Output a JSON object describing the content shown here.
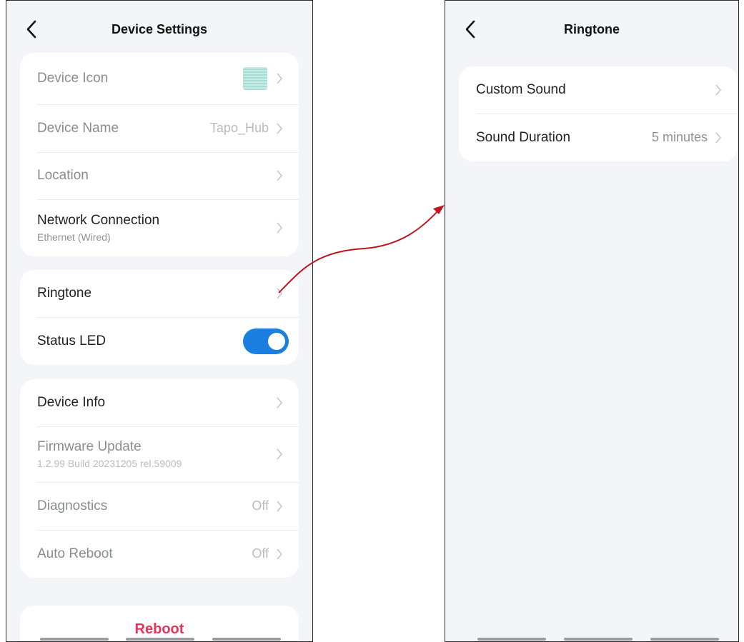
{
  "left": {
    "title": "Device Settings",
    "group1": {
      "device_icon_label": "Device Icon",
      "device_name_label": "Device Name",
      "device_name_value": "Tapo_Hub",
      "location_label": "Location",
      "network_label": "Network Connection",
      "network_sub": "Ethernet (Wired)"
    },
    "group2": {
      "ringtone_label": "Ringtone",
      "status_led_label": "Status LED",
      "status_led_on": true
    },
    "group3": {
      "device_info_label": "Device Info",
      "firmware_label": "Firmware Update",
      "firmware_sub": "1.2.99 Build 20231205 rel.59009",
      "diagnostics_label": "Diagnostics",
      "diagnostics_value": "Off",
      "auto_reboot_label": "Auto Reboot",
      "auto_reboot_value": "Off"
    },
    "reboot_label": "Reboot"
  },
  "right": {
    "title": "Ringtone",
    "custom_sound_label": "Custom Sound",
    "sound_duration_label": "Sound Duration",
    "sound_duration_value": "5 minutes"
  },
  "colors": {
    "background": "#f4f5f8",
    "toggle_on": "#1a7fe0",
    "reboot": "#e8335a",
    "annotation_arrow": "#c0141e"
  }
}
